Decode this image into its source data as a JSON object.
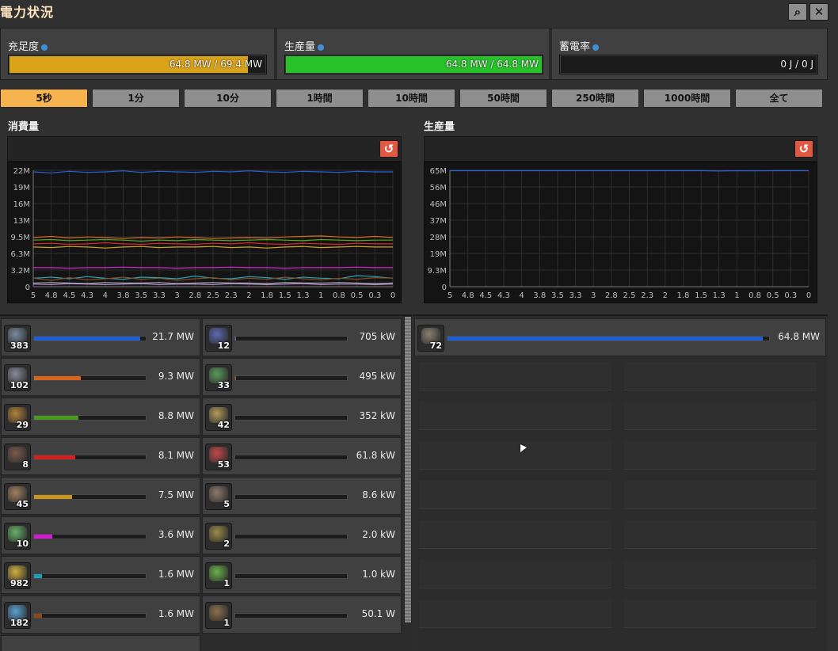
{
  "window": {
    "title": "電力状況"
  },
  "header_buttons": {
    "search_icon": "⌕",
    "close_icon": "✕"
  },
  "gauges": [
    {
      "label": "充足度",
      "value_text": "64.8 MW / 69.4 MW",
      "fill": 0.933,
      "color": "#d9a21b"
    },
    {
      "label": "生産量",
      "value_text": "64.8 MW / 64.8 MW",
      "fill": 1.0,
      "color": "#28c22a"
    },
    {
      "label": "蓄電率",
      "value_text": "0 J / 0 J",
      "fill": 0.0,
      "color": "#888888"
    }
  ],
  "time_tabs": [
    "5秒",
    "1分",
    "10分",
    "1時間",
    "10時間",
    "50時間",
    "250時間",
    "1000時間",
    "全て"
  ],
  "active_tab": 0,
  "consumption": {
    "title": "消費量",
    "reset_icon": "↺",
    "chart_data": {
      "type": "line",
      "x": [
        5,
        4.8,
        4.5,
        4.3,
        4,
        3.8,
        3.5,
        3.3,
        3,
        2.8,
        2.5,
        2.3,
        2,
        1.8,
        1.5,
        1.3,
        1,
        0.8,
        0.5,
        0.3,
        0
      ],
      "x_tick_labels": [
        "5",
        "4.8",
        "4.5",
        "4.3",
        "4",
        "3.8",
        "3.5",
        "3.3",
        "3",
        "2.8",
        "2.5",
        "2.3",
        "2",
        "1.8",
        "1.5",
        "1.3",
        "1",
        "0.8",
        "0.5",
        "0.3",
        "0"
      ],
      "y_tick_labels": [
        "22M",
        "19M",
        "16M",
        "13M",
        "9.5M",
        "6.3M",
        "3.2M",
        "0"
      ],
      "ylim": [
        0,
        22
      ],
      "grid": true,
      "series": [
        {
          "color": "#2b5fd6",
          "values": [
            21.7,
            21.5,
            21.8,
            21.6,
            21.7,
            21.9,
            21.6,
            21.8,
            21.7,
            21.6,
            21.8,
            21.7,
            21.9,
            21.7,
            21.6,
            21.8,
            21.7,
            21.6,
            21.8,
            21.7,
            21.7
          ]
        },
        {
          "color": "#d76a22",
          "values": [
            9.3,
            9.5,
            9.2,
            9.4,
            9.3,
            9.1,
            9.3,
            9.2,
            9.4,
            9.3,
            9.1,
            9.2,
            9.3,
            9.2,
            9.4,
            9.5,
            9.6,
            9.4,
            9.3,
            9.5,
            9.3
          ]
        },
        {
          "color": "#59a52a",
          "values": [
            8.8,
            8.9,
            8.7,
            8.8,
            8.9,
            8.8,
            8.6,
            8.8,
            8.7,
            8.9,
            8.8,
            8.7,
            8.8,
            8.9,
            8.8,
            8.7,
            8.9,
            8.8,
            8.7,
            8.8,
            8.8
          ]
        },
        {
          "color": "#d42828",
          "values": [
            8.1,
            8.2,
            8.0,
            8.1,
            8.3,
            8.1,
            8.0,
            8.2,
            8.1,
            8.0,
            8.2,
            8.1,
            8.3,
            8.1,
            8.0,
            8.2,
            8.1,
            8.0,
            8.2,
            8.1,
            8.1
          ]
        },
        {
          "color": "#d3a02a",
          "values": [
            7.5,
            7.4,
            7.6,
            7.5,
            7.3,
            7.5,
            7.6,
            7.4,
            7.5,
            7.5,
            7.6,
            7.4,
            7.5,
            7.3,
            7.5,
            7.6,
            7.4,
            7.5,
            7.6,
            7.5,
            7.5
          ]
        },
        {
          "color": "#d12ad1",
          "values": [
            3.6,
            3.6,
            3.5,
            3.6,
            3.6,
            3.7,
            3.6,
            3.6,
            3.5,
            3.6,
            3.6,
            3.7,
            3.6,
            3.6,
            3.5,
            3.6,
            3.6,
            3.6,
            3.7,
            3.6,
            3.6
          ]
        },
        {
          "color": "#23a6b5",
          "values": [
            1.6,
            1.8,
            1.5,
            1.9,
            1.6,
            1.4,
            1.8,
            1.7,
            1.5,
            2.0,
            1.6,
            1.5,
            1.9,
            1.7,
            1.4,
            1.8,
            1.6,
            1.5,
            2.1,
            1.9,
            1.6
          ]
        },
        {
          "color": "#8a4a2a",
          "values": [
            1.6,
            1.2,
            1.7,
            1.3,
            1.5,
            1.8,
            1.4,
            1.6,
            1.2,
            1.5,
            1.7,
            1.3,
            1.6,
            1.4,
            1.8,
            1.5,
            1.3,
            1.6,
            1.4,
            1.7,
            1.6
          ]
        },
        {
          "color": "#9a9a9a",
          "values": [
            0.7,
            0.8,
            0.7,
            0.6,
            0.8,
            0.7,
            0.7,
            0.8,
            0.6,
            0.7,
            0.8,
            0.7,
            0.7,
            0.6,
            0.8,
            0.7,
            0.7,
            0.8,
            0.7,
            0.6,
            0.7
          ]
        },
        {
          "color": "#c8a0e8",
          "values": [
            0.5,
            0.4,
            0.6,
            0.5,
            0.4,
            0.5,
            0.6,
            0.4,
            0.5,
            0.5,
            0.4,
            0.6,
            0.5,
            0.4,
            0.5,
            0.6,
            0.4,
            0.5,
            0.5,
            0.4,
            0.5
          ]
        }
      ]
    },
    "items": [
      {
        "icon": "assembler-icon",
        "color": "#7a8aa0",
        "count": "383",
        "value": "21.7 MW",
        "fill": 0.95,
        "bar_color": "#1f5fd6"
      },
      {
        "icon": "lab-icon",
        "color": "#5a6ab0",
        "count": "12",
        "value": "705 kW",
        "fill": 0.01,
        "bar_color": "#5a6ab0"
      },
      {
        "icon": "electric-furnace-icon",
        "color": "#8a8a9a",
        "count": "102",
        "value": "9.3 MW",
        "fill": 0.42,
        "bar_color": "#d9641c"
      },
      {
        "icon": "pumpjack-icon",
        "color": "#5a9a5a",
        "count": "33",
        "value": "495 kW",
        "fill": 0.01,
        "bar_color": "#c04a2a"
      },
      {
        "icon": "chemical-plant-icon",
        "color": "#b0803a",
        "count": "29",
        "value": "8.8 MW",
        "fill": 0.4,
        "bar_color": "#4a9a1e"
      },
      {
        "icon": "roboport-icon",
        "color": "#b09a5a",
        "count": "42",
        "value": "352 kW",
        "fill": 0.0,
        "bar_color": "#888888"
      },
      {
        "icon": "oil-refinery-icon",
        "color": "#7a5a4a",
        "count": "8",
        "value": "8.1 MW",
        "fill": 0.37,
        "bar_color": "#d42020"
      },
      {
        "icon": "inserter-icon",
        "color": "#c04a4a",
        "count": "53",
        "value": "61.8 kW",
        "fill": 0.0,
        "bar_color": "#888888"
      },
      {
        "icon": "centrifuge-icon",
        "color": "#a08060",
        "count": "45",
        "value": "7.5 MW",
        "fill": 0.34,
        "bar_color": "#c8961e"
      },
      {
        "icon": "mining-drill-icon",
        "color": "#8a7a6a",
        "count": "5",
        "value": "8.6 kW",
        "fill": 0.0,
        "bar_color": "#888888"
      },
      {
        "icon": "beacon-icon",
        "color": "#6ab06a",
        "count": "10",
        "value": "3.6 MW",
        "fill": 0.16,
        "bar_color": "#d41ad4"
      },
      {
        "icon": "radar-icon",
        "color": "#9a8a4a",
        "count": "2",
        "value": "2.0 kW",
        "fill": 0.0,
        "bar_color": "#888888"
      },
      {
        "icon": "fast-inserter-icon",
        "color": "#d0b040",
        "count": "982",
        "value": "1.6 MW",
        "fill": 0.07,
        "bar_color": "#1aa0b8"
      },
      {
        "icon": "long-inserter-icon",
        "color": "#6ab04a",
        "count": "1",
        "value": "1.0 kW",
        "fill": 0.0,
        "bar_color": "#888888"
      },
      {
        "icon": "stack-inserter-icon",
        "color": "#5aa0d0",
        "count": "182",
        "value": "1.6 MW",
        "fill": 0.07,
        "bar_color": "#8a4a20"
      },
      {
        "icon": "offshore-pump-icon",
        "color": "#8a7050",
        "count": "1",
        "value": "50.1 W",
        "fill": 0.0,
        "bar_color": "#888888"
      }
    ]
  },
  "production": {
    "title": "生産量",
    "reset_icon": "↺",
    "chart_data": {
      "type": "line",
      "x": [
        5,
        4.8,
        4.5,
        4.3,
        4,
        3.8,
        3.5,
        3.3,
        3,
        2.8,
        2.5,
        2.3,
        2,
        1.8,
        1.5,
        1.3,
        1,
        0.8,
        0.5,
        0.3,
        0
      ],
      "x_tick_labels": [
        "5",
        "4.8",
        "4.5",
        "4.3",
        "4",
        "3.8",
        "3.5",
        "3.3",
        "3",
        "2.8",
        "2.5",
        "2.3",
        "2",
        "1.8",
        "1.5",
        "1.3",
        "1",
        "0.8",
        "0.5",
        "0.3",
        "0"
      ],
      "y_tick_labels": [
        "65M",
        "56M",
        "46M",
        "37M",
        "28M",
        "19M",
        "9.3M",
        "0"
      ],
      "ylim": [
        0,
        65
      ],
      "grid": true,
      "series": [
        {
          "color": "#2b5fd6",
          "values": [
            64.8,
            64.8,
            64.8,
            64.8,
            64.8,
            64.8,
            64.8,
            64.8,
            64.8,
            64.8,
            64.8,
            64.8,
            64.8,
            64.8,
            64.8,
            64.6,
            64.8,
            64.7,
            64.8,
            64.8,
            64.8
          ]
        }
      ]
    },
    "items": [
      {
        "icon": "steam-engine-icon",
        "color": "#8a8070",
        "count": "72",
        "value": "64.8 MW",
        "fill": 0.98,
        "bar_color": "#1f5fd6"
      }
    ]
  }
}
